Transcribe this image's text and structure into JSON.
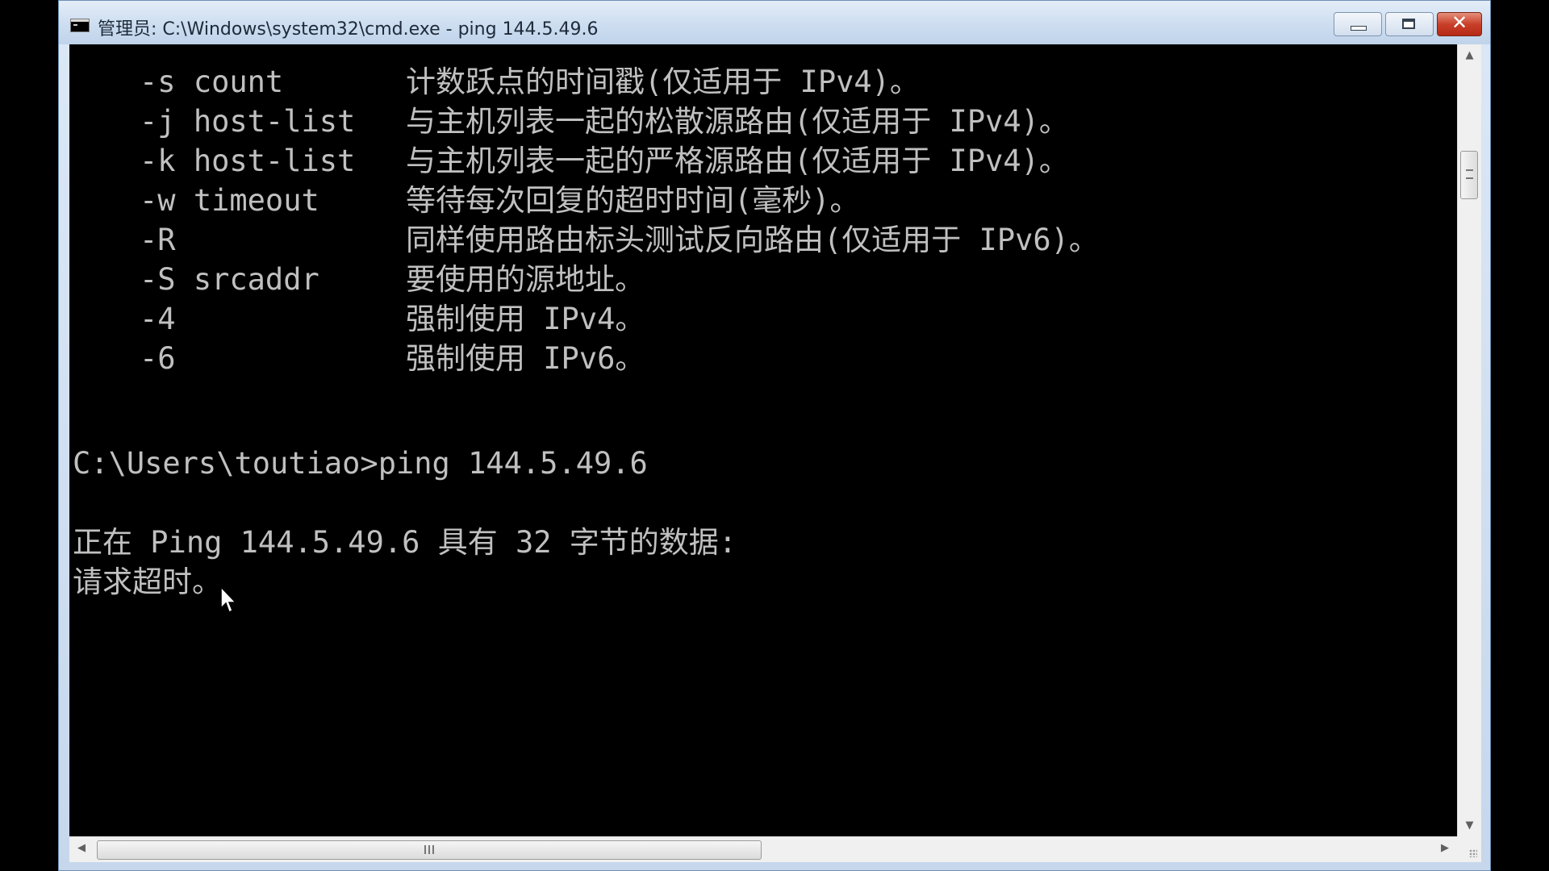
{
  "window": {
    "title": "管理员: C:\\Windows\\system32\\cmd.exe - ping  144.5.49.6",
    "minimize_label": "",
    "maximize_label": "",
    "close_symbol": "✕"
  },
  "console": {
    "help_rows": [
      {
        "option": "-s count",
        "description": "计数跃点的时间戳(仅适用于 IPv4)。"
      },
      {
        "option": "-j host-list",
        "description": "与主机列表一起的松散源路由(仅适用于 IPv4)。"
      },
      {
        "option": "-k host-list",
        "description": "与主机列表一起的严格源路由(仅适用于 IPv4)。"
      },
      {
        "option": "-w timeout",
        "description": "等待每次回复的超时时间(毫秒)。"
      },
      {
        "option": "-R",
        "description": "同样使用路由标头测试反向路由(仅适用于 IPv6)。"
      },
      {
        "option": "-S srcaddr",
        "description": "要使用的源地址。"
      },
      {
        "option": "-4",
        "description": "强制使用 IPv4。"
      },
      {
        "option": "-6",
        "description": "强制使用 IPv6。"
      }
    ],
    "prompt_line": "C:\\Users\\toutiao>ping 144.5.49.6",
    "pinging_line": "正在 Ping 144.5.49.6 具有 32 字节的数据:",
    "timeout_line": "请求超时。"
  },
  "scrollbars": {
    "up_arrow": "▲",
    "down_arrow": "▼",
    "left_arrow": "◀",
    "right_arrow": "▶"
  },
  "colors": {
    "console_background": "#000000",
    "console_text": "#c0c0c0",
    "close_button": "#c9402a"
  }
}
